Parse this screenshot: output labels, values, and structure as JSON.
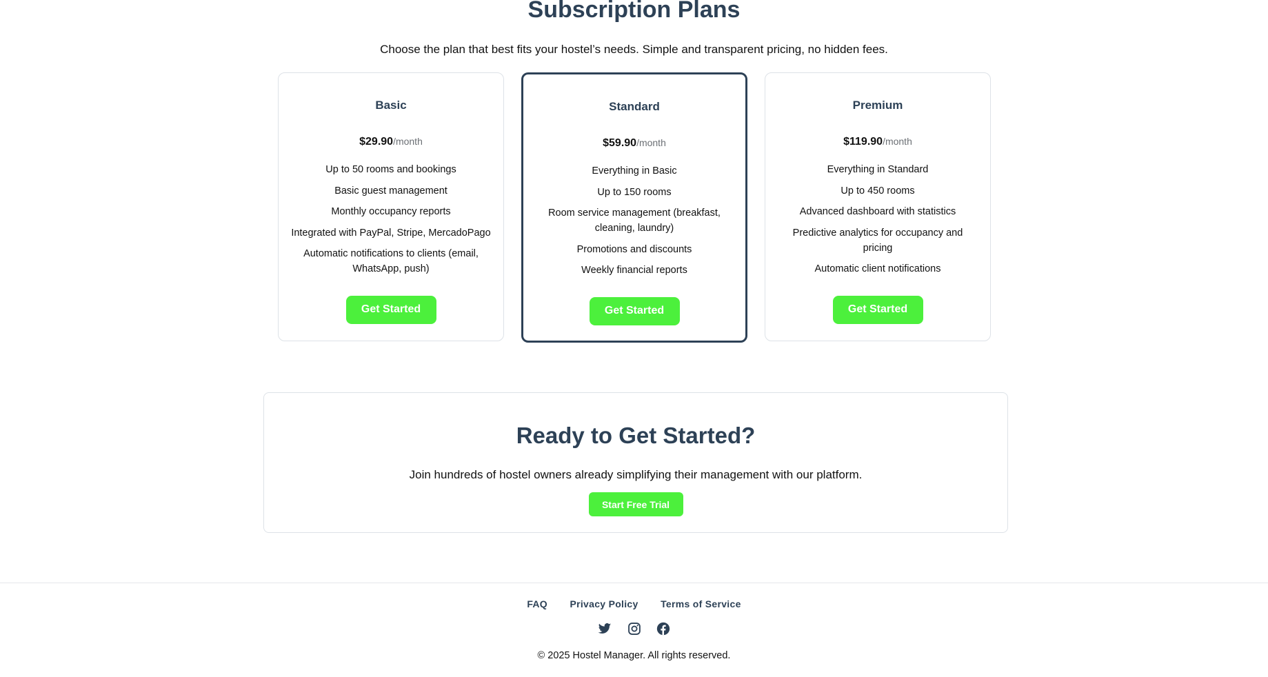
{
  "header": {
    "title": "Subscription Plans",
    "subtitle": "Choose the plan that best fits your hostel’s needs. Simple and transparent pricing, no hidden fees."
  },
  "plans": [
    {
      "name": "Basic",
      "price": "$29.90",
      "period": "/month",
      "features": [
        "Up to 50 rooms and bookings",
        "Basic guest management",
        "Monthly occupancy reports",
        "Integrated with PayPal, Stripe, MercadoPago",
        "Automatic notifications to clients (email, WhatsApp, push)"
      ],
      "cta": "Get Started"
    },
    {
      "name": "Standard",
      "price": "$59.90",
      "period": "/month",
      "features": [
        "Everything in Basic",
        "Up to 150 rooms",
        "Room service management (breakfast, cleaning, laundry)",
        "Promotions and discounts",
        "Weekly financial reports"
      ],
      "cta": "Get Started"
    },
    {
      "name": "Premium",
      "price": "$119.90",
      "period": "/month",
      "features": [
        "Everything in Standard",
        "Up to 450 rooms",
        "Advanced dashboard with statistics",
        "Predictive analytics for occupancy and pricing",
        "Automatic client notifications"
      ],
      "cta": "Get Started"
    }
  ],
  "cta_section": {
    "title": "Ready to Get Started?",
    "text": "Join hundreds of hostel owners already simplifying their management with our platform.",
    "button": "Start Free Trial"
  },
  "footer": {
    "links": [
      "FAQ",
      "Privacy Policy",
      "Terms of Service"
    ],
    "social_icons": [
      "twitter-icon",
      "instagram-icon",
      "facebook-icon"
    ],
    "copyright": "© 2025 Hostel Manager. All rights reserved."
  },
  "colors": {
    "heading": "#2d4156",
    "accent": "#4cf03c",
    "border": "#dde2e7"
  }
}
